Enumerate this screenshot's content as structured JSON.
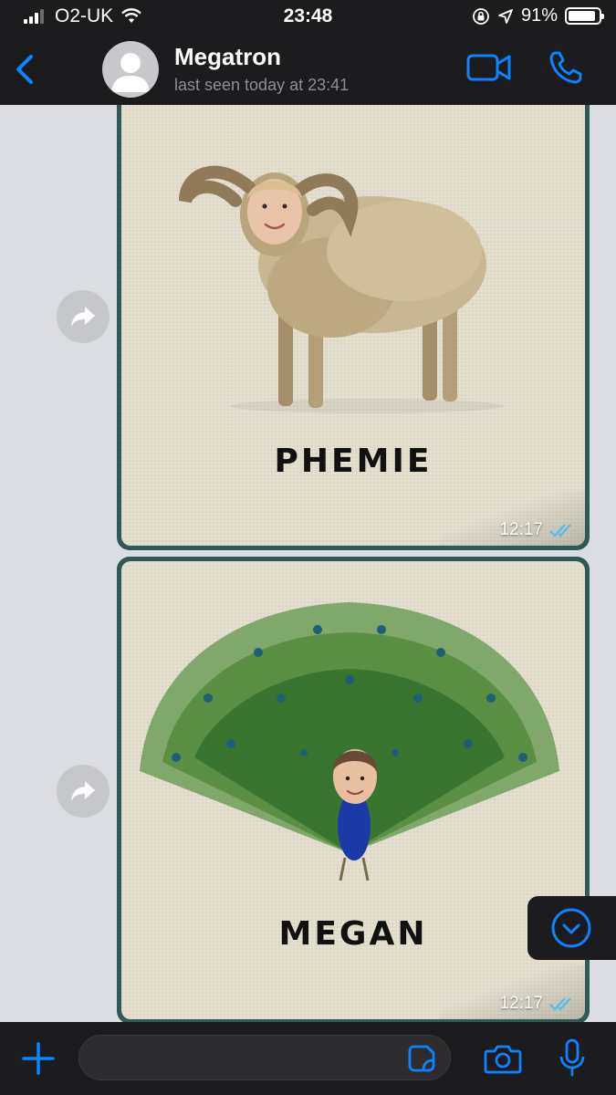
{
  "status_bar": {
    "carrier": "O2-UK",
    "time": "23:48",
    "battery_percent": "91%",
    "battery_level": 0.91,
    "icons": [
      "signal-icon",
      "wifi-icon",
      "orientation-lock-icon",
      "location-icon",
      "battery-icon"
    ]
  },
  "header": {
    "back_icon": "chevron-left-icon",
    "contact_name": "Megatron",
    "last_seen": "last seen today at 23:41",
    "video_icon": "video-camera-icon",
    "call_icon": "phone-icon"
  },
  "messages": [
    {
      "type": "image",
      "caption_text": "PHEMIE",
      "image_subject": "ram with face",
      "time": "12:17",
      "status": "read"
    },
    {
      "type": "image",
      "caption_text": "MEGAN",
      "image_subject": "peacock with face",
      "time": "12:17",
      "status": "read"
    }
  ],
  "input_bar": {
    "placeholder": "",
    "icons": [
      "plus-icon",
      "sticker-icon",
      "camera-icon",
      "microphone-icon"
    ]
  },
  "colors": {
    "accent": "#0a84ff",
    "header_bg": "#1c1c1e",
    "chat_bg": "#dcdde2",
    "bubble_border": "#2f5856",
    "read_receipt": "#53bdeb"
  }
}
